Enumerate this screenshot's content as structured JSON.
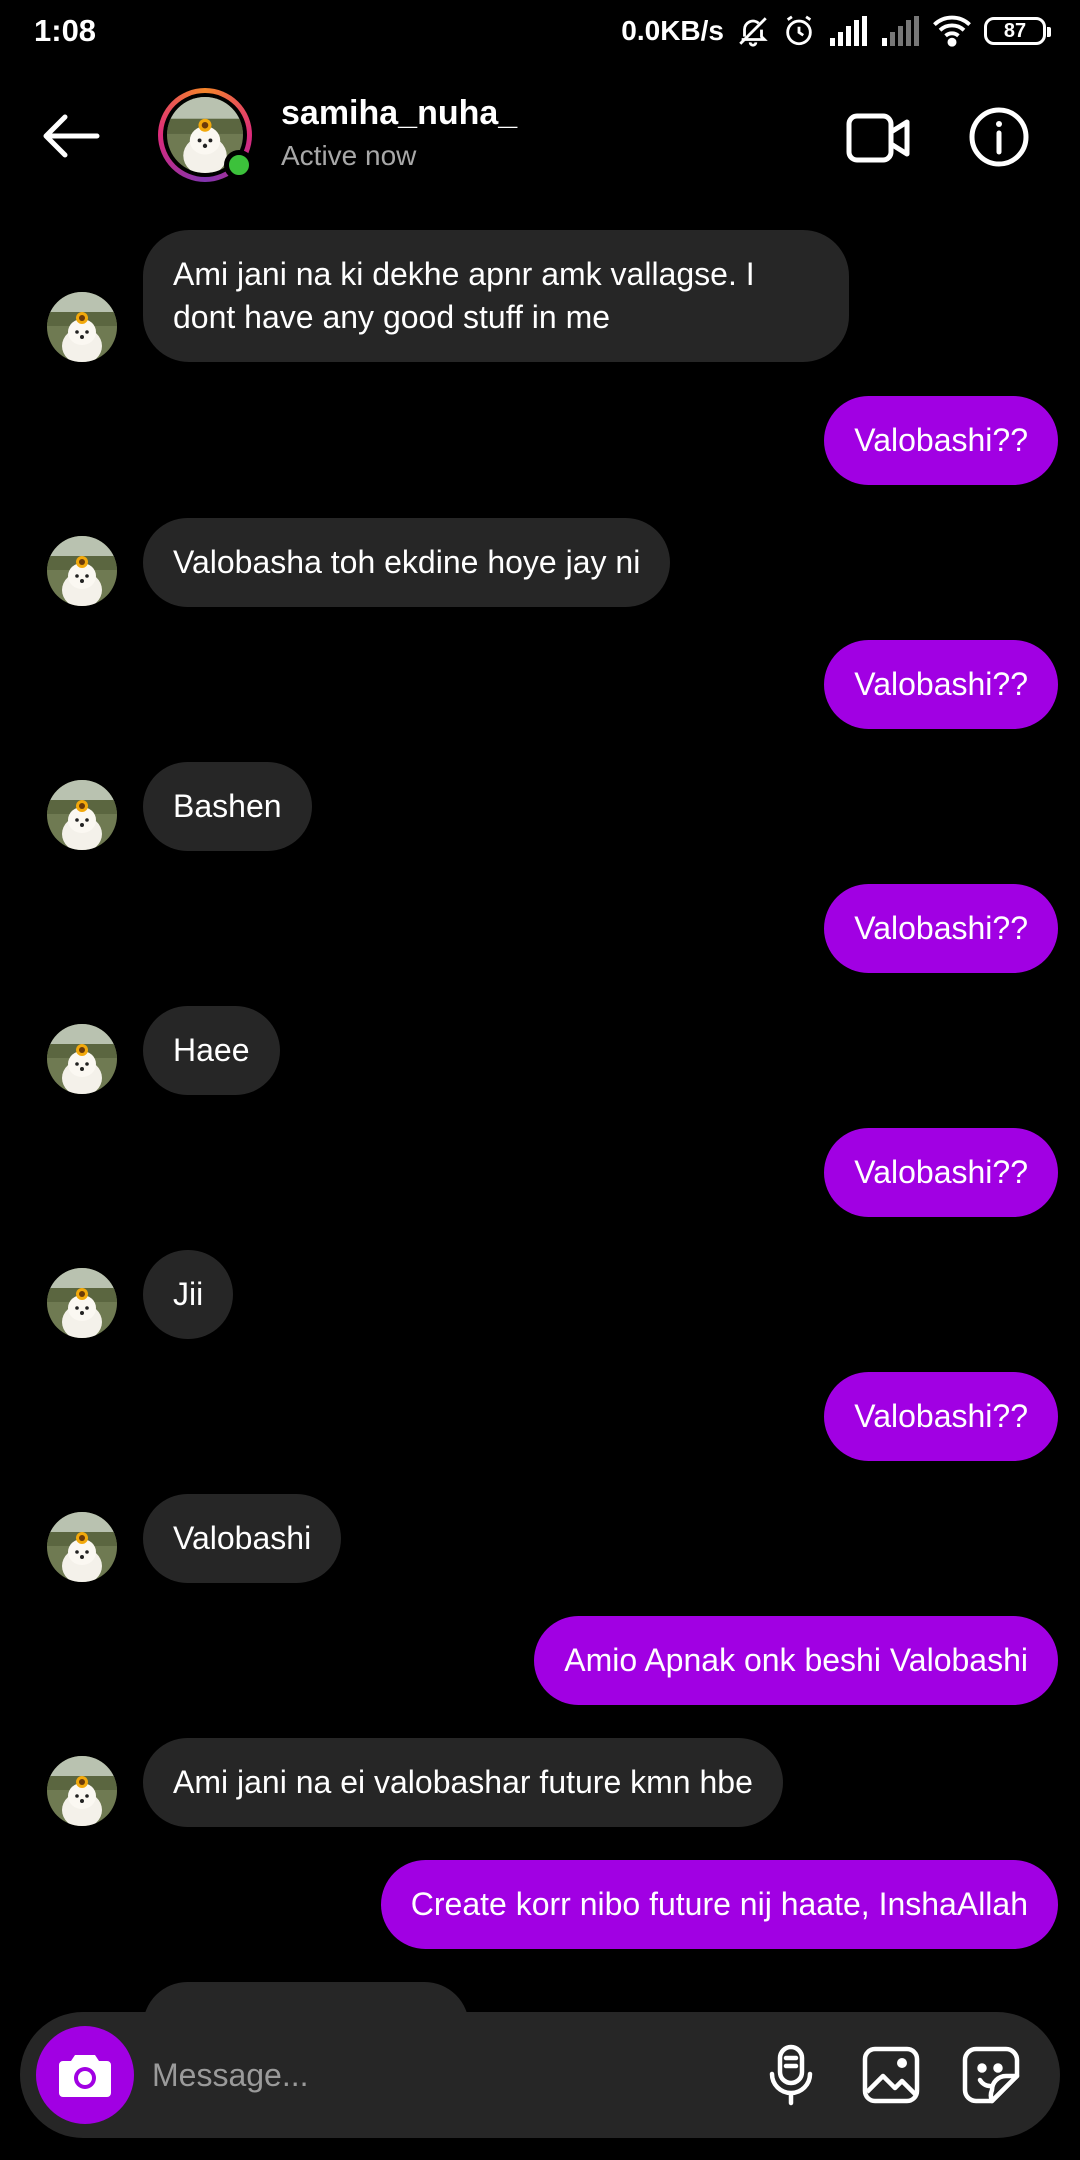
{
  "status_bar": {
    "time": "1:08",
    "net_speed": "0.0KB/s",
    "battery": "87"
  },
  "header": {
    "username": "samiha_nuha_",
    "status": "Active now",
    "icons": [
      "back-arrow-icon",
      "video-call-icon",
      "info-icon"
    ]
  },
  "colors": {
    "background": "#000000",
    "incoming_bubble": "#262626",
    "outgoing_bubble": "#a100e3",
    "online": "#3cc13b"
  },
  "messages": [
    {
      "from": "them",
      "text": "Ami jani na ki dekhe apnr amk vallagse. I",
      "text2": "dont have any good stuff in me"
    },
    {
      "from": "me",
      "text": "Valobashi??"
    },
    {
      "from": "them",
      "text": "Valobasha toh ekdine hoye jay ni"
    },
    {
      "from": "me",
      "text": "Valobashi??"
    },
    {
      "from": "them",
      "text": "Bashen"
    },
    {
      "from": "me",
      "text": "Valobashi??"
    },
    {
      "from": "them",
      "text": "Haee"
    },
    {
      "from": "me",
      "text": "Valobashi??"
    },
    {
      "from": "them",
      "text": "Jii"
    },
    {
      "from": "me",
      "text": "Valobashi??"
    },
    {
      "from": "them",
      "text": "Valobashi"
    },
    {
      "from": "me",
      "text": "Amio Apnak onk beshi Valobashi"
    },
    {
      "from": "them",
      "text": "Ami jani na ei valobashar future kmn hbe"
    },
    {
      "from": "me",
      "text": "Create korr nibo future nij haate, InshaAllah"
    }
  ],
  "composer": {
    "placeholder": "Message...",
    "icons": [
      "camera-icon",
      "microphone-icon",
      "gallery-icon",
      "sticker-icon"
    ]
  }
}
